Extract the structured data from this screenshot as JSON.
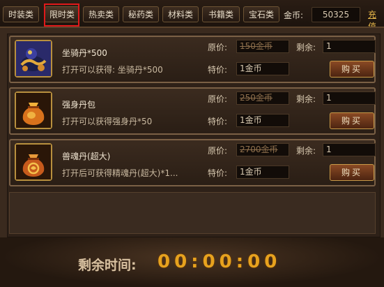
{
  "tabs": [
    {
      "label": "时装类"
    },
    {
      "label": "限时类"
    },
    {
      "label": "热卖类"
    },
    {
      "label": "秘药类"
    },
    {
      "label": "材料类"
    },
    {
      "label": "书籍类"
    },
    {
      "label": "宝石类"
    }
  ],
  "gold": {
    "label": "金币:",
    "value": "50325",
    "recharge": "充值"
  },
  "labels": {
    "original_price": "原价:",
    "remaining": "剩余:",
    "special_price": "特价:",
    "buy": "购买"
  },
  "items": [
    {
      "name": "坐骑丹*500",
      "desc": "打开可以获得: 坐骑丹*500",
      "original_price": "150金币",
      "special_price": "1金币",
      "remaining": "1",
      "icon": "mount-pill-icon"
    },
    {
      "name": "强身丹包",
      "desc": "打开可以获得强身丹*50",
      "original_price": "250金币",
      "special_price": "1金币",
      "remaining": "1",
      "icon": "pouch-icon"
    },
    {
      "name": "兽魂丹(超大)",
      "desc": "打开后可获得精魂丹(超大)*1...",
      "original_price": "2700金币",
      "special_price": "1金币",
      "remaining": "1",
      "icon": "pouch-icon"
    }
  ],
  "timer": {
    "label": "剩余时间:",
    "value": "00:00:00"
  },
  "colors": {
    "accent_gold": "#e7a21e",
    "tab_highlight": "#e0191a",
    "button": "#8a4a24"
  }
}
